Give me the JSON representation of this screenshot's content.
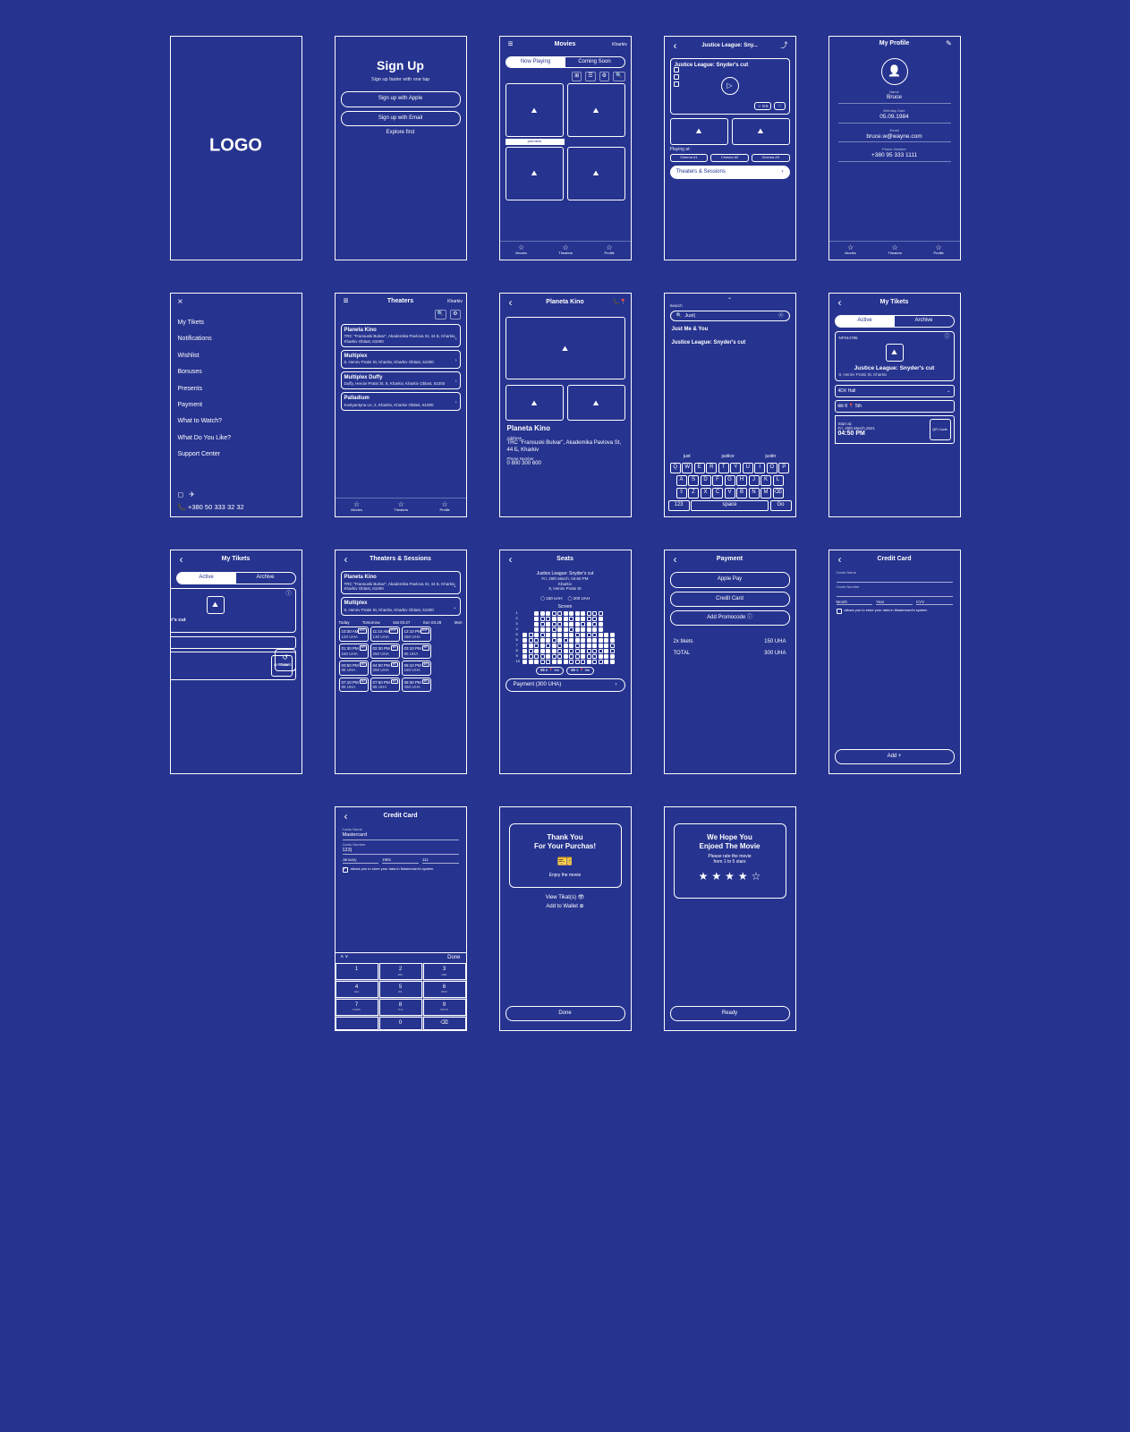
{
  "logo": "LOGO",
  "signup": {
    "title": "Sign Up",
    "sub": "Sign up faster with one tap",
    "apple": "Sign up with Apple",
    "email": "Sign up with Email",
    "explore": "Explore first"
  },
  "movies": {
    "title": "Movies",
    "city": "Kharkiv",
    "tab_now": "Now Playing",
    "tab_soon": "Coming Soon",
    "premiere": "premiere"
  },
  "movieDetail": {
    "header": "Justice League: Sny...",
    "title": "Justice League: Snyder's cut",
    "rating": "☆ 8.5",
    "playing_at": "Playing at:",
    "cinema1": "Cinema #1",
    "cinema2": "Cinema #2",
    "cinema3": "Cinema #3",
    "cta": "Theaters & Sessions"
  },
  "profile": {
    "title": "My Profile",
    "name_lbl": "Name",
    "name": "Bruce",
    "bday_lbl": "Birthday Date",
    "bday": "05.09.1984",
    "email_lbl": "Email",
    "email": "bruce.w@wayne.com",
    "phone_lbl": "Phone Number",
    "phone": "+380 95 333 1111"
  },
  "tabs": {
    "movies": "Movies",
    "theaters": "Theaters",
    "profile": "Profile"
  },
  "menu": {
    "items": [
      "My Tikets",
      "Notifications",
      "Wishlist",
      "Bonuses",
      "Presents",
      "Payment",
      "What to Watch?",
      "What Do You Like?",
      "Support Center"
    ],
    "phone": "+380 50 333 32 32"
  },
  "theaters": {
    "title": "Theaters",
    "city": "Kharkiv",
    "list": [
      {
        "name": "Planeta Kino",
        "addr": "TRC \"Fransuski Bulvar\", Akademika Pavlova St, 44 Б, Kharkiv, Kharkiv Oblast, 61000"
      },
      {
        "name": "Multiplex",
        "addr": "8, Heroiv Pratsi St, Kharkiv, Kharkiv Oblast, 61000"
      },
      {
        "name": "Multiplex Duffy",
        "addr": "Duffy, Heroiv Pratsi St, 9, Kharkiv, Kharkiv Oblast, 61000"
      },
      {
        "name": "Palladium",
        "addr": "Kostyantyna Ln, 2, Kharkiv, Kharkiv Oblast, 61000"
      }
    ]
  },
  "theaterDetail": {
    "title": "Planeta Kino",
    "addr_lbl": "Address",
    "addr": "TRC \"Fransuski Bulvar\", Akademika Pavlova St, 44 Б, Kharkiv",
    "phone_lbl": "Phone Number",
    "phone": "0 800 300 600"
  },
  "search": {
    "label": "Search",
    "query": "Just|",
    "r1": "Just Me & You",
    "r2": "Justice League: Snyder's cut",
    "suggest": [
      "just",
      "justice",
      "justin"
    ],
    "space": "space",
    "go": "Go",
    "num": "123"
  },
  "tickets": {
    "title": "My Tikets",
    "active": "Active",
    "archive": "Archive",
    "code": "NF044785",
    "movie": "Justice League: Snyder's cut",
    "addr": "8, Heroiv Pratsi St, Kharkiv",
    "hall": "4DX Hall",
    "seat": "🎟 8    📍 5th",
    "start_lbl": "Start at:",
    "date": "Fri, 25th March,2021",
    "time": "04:50 PM",
    "qr": "QR Code",
    "return": "Return"
  },
  "sessions": {
    "title": "Theaters & Sessions",
    "days": [
      "Today",
      "Tomorrow",
      "Sat 03.27",
      "Sun 03.28",
      "Mon"
    ],
    "cells": [
      {
        "t": "10:30 AM",
        "p": "120 UHA",
        "g": "4DX"
      },
      {
        "t": "11:10 AM",
        "p": "130 UHA",
        "g": "4DX"
      },
      {
        "t": "12:10 PM",
        "p": "250 UHA",
        "g": "4DX"
      },
      {
        "t": "",
        "p": "",
        "g": ""
      },
      {
        "t": "01:30 PM",
        "p": "150 UHA",
        "g": "3D"
      },
      {
        "t": "02:30 PM",
        "p": "250 UHA",
        "g": "3D"
      },
      {
        "t": "03:10 PM",
        "p": "85 UHA",
        "g": "3D"
      },
      {
        "t": "",
        "p": "",
        "g": ""
      },
      {
        "t": "03:50 PM",
        "p": "85 UHA",
        "g": "3D"
      },
      {
        "t": "04:50 PM",
        "p": "250 UHA",
        "g": "3D"
      },
      {
        "t": "06:10 PM",
        "p": "150 UHA",
        "g": "3D"
      },
      {
        "t": "",
        "p": "",
        "g": ""
      },
      {
        "t": "07:10 PM",
        "p": "85 UHA",
        "g": "3D"
      },
      {
        "t": "07:50 PM",
        "p": "85 UHA",
        "g": "3D"
      },
      {
        "t": "08:30 PM",
        "p": "250 UHA",
        "g": "3D"
      }
    ]
  },
  "seats": {
    "title": "Seats",
    "movie": "Justice League: Snyder's cut",
    "date": "Fri, 26th March, 04:50 PM",
    "city": "Kharkiv",
    "addr": "8, Heroiv Pratsi St",
    "legend1": "◯ 150 UAH",
    "legend2": "◯ 200 UAH",
    "screen": "Screen",
    "chip1": "🎟 8   📍 5th",
    "chip2": "🎟 9   📍 5th",
    "pay_btn": "Payment (300 UHA)"
  },
  "payment": {
    "title": "Payment",
    "apple": "Apple Pay",
    "cc": "Credit Card",
    "promo": "Add Promocode ⓘ",
    "line1_k": "2x tikets",
    "line1_v": "150 UHA",
    "line2_k": "TOTAL",
    "line2_v": "300 UHA"
  },
  "cc": {
    "title": "Credit Card",
    "name_lbl": "Cards Name",
    "num_lbl": "Cards Number",
    "month": "Month",
    "year": "Year",
    "cvv": "CVV",
    "consent": "allows you to store your data in Mastercard's system",
    "add": "Add  +"
  },
  "ccFilled": {
    "name": "Mastercard",
    "num": "123|",
    "month": "January",
    "year": "1991",
    "cvv": "111",
    "done": "Done"
  },
  "thanks": {
    "title1": "Thank You",
    "title2": "For Your Purchas!",
    "sub": "Enjoy the movie",
    "view": "View Tikat(s) 👁",
    "wallet": "Add to Wallet ⊕",
    "done": "Done"
  },
  "rate": {
    "title1": "We Hope You",
    "title2": "Enjoed The Movie",
    "sub1": "Please rate the movie",
    "sub2": "from 1 to 5 stars",
    "ready": "Ready"
  }
}
